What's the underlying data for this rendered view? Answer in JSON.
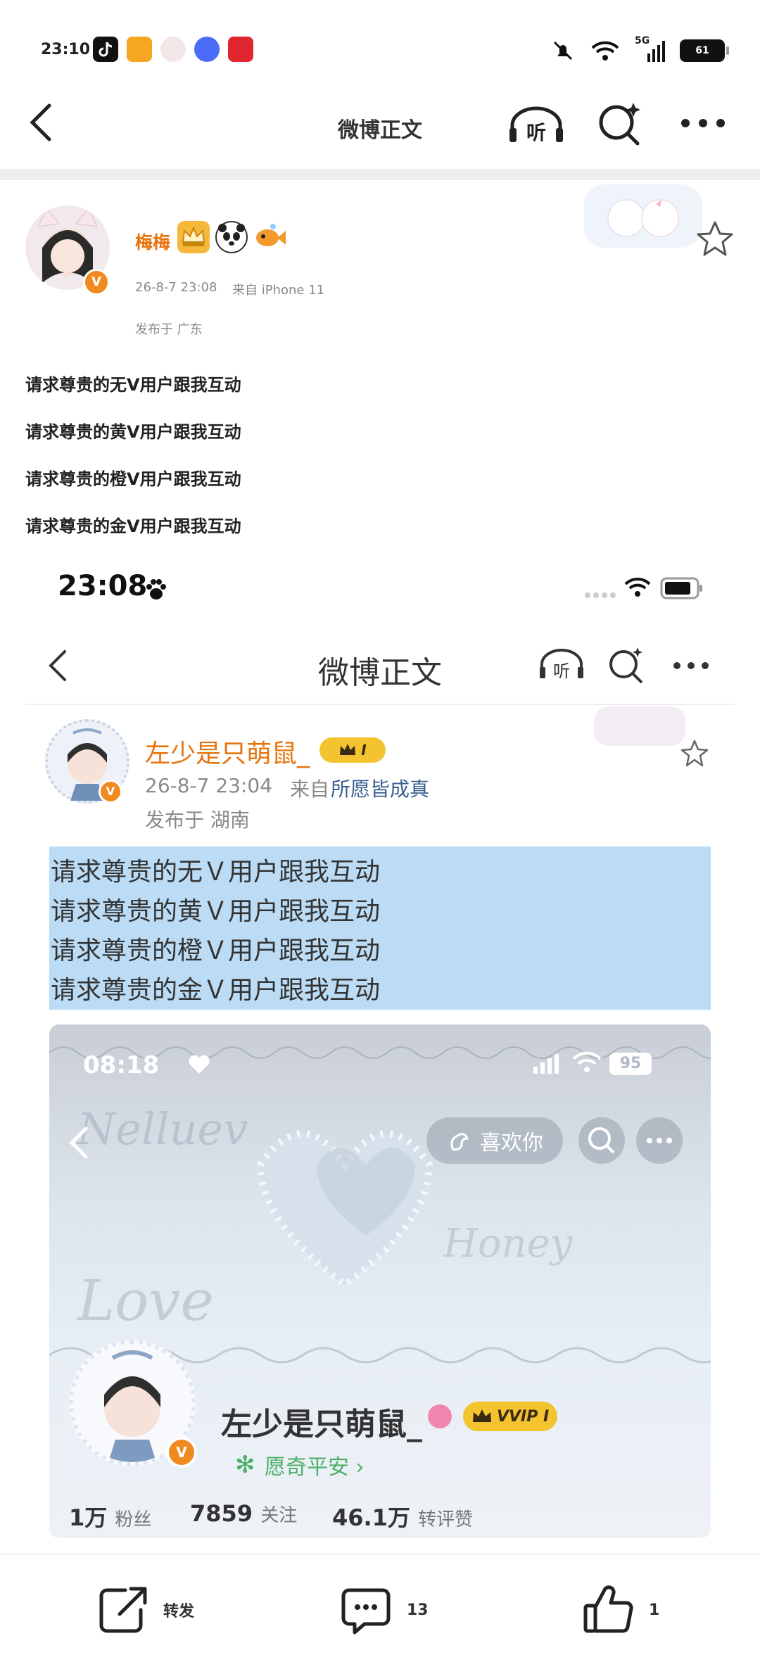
{
  "status_bar": {
    "time": "23:10",
    "battery": "61",
    "network": "5G"
  },
  "nav": {
    "title": "微博正文"
  },
  "post": {
    "author": "梅梅",
    "time": "26-8-7 23:08",
    "source": "来自 iPhone 11",
    "location": "发布于 广东",
    "lines": [
      "请求尊贵的无V用户跟我互动",
      "请求尊贵的黄V用户跟我互动",
      "请求尊贵的橙V用户跟我互动",
      "请求尊贵的金V用户跟我互动"
    ]
  },
  "embedded": {
    "status_time": "23:08",
    "nav_title": "微博正文",
    "author": "左少是只萌鼠_",
    "badge": "I",
    "time": "26-8-7 23:04",
    "source_prefix": "来自",
    "source_app": "所愿皆成真",
    "location": "发布于 湖南",
    "lines": [
      "请求尊贵的无Ｖ用户跟我互动",
      "请求尊贵的黄Ｖ用户跟我互动",
      "请求尊贵的橙Ｖ用户跟我互动",
      "请求尊贵的金Ｖ用户跟我互动"
    ],
    "profile_card": {
      "status_time": "08:18",
      "battery": "95",
      "like_button": "喜欢你",
      "name": "左少是只萌鼠_",
      "vip_badge": "VVIP I",
      "tag": "愿奇平安 ›",
      "fans_count": "1万",
      "fans_label": "粉丝",
      "follow_count": "7859",
      "follow_label": "关注",
      "likes_count": "46.1万",
      "likes_label": "转评赞"
    }
  },
  "bottom_bar": {
    "repost_label": "转发",
    "comment_count": "13",
    "like_count": "1"
  },
  "colors": {
    "accent": "#e8730c",
    "selection": "#bcdcf5",
    "link": "#3a5f8f"
  }
}
